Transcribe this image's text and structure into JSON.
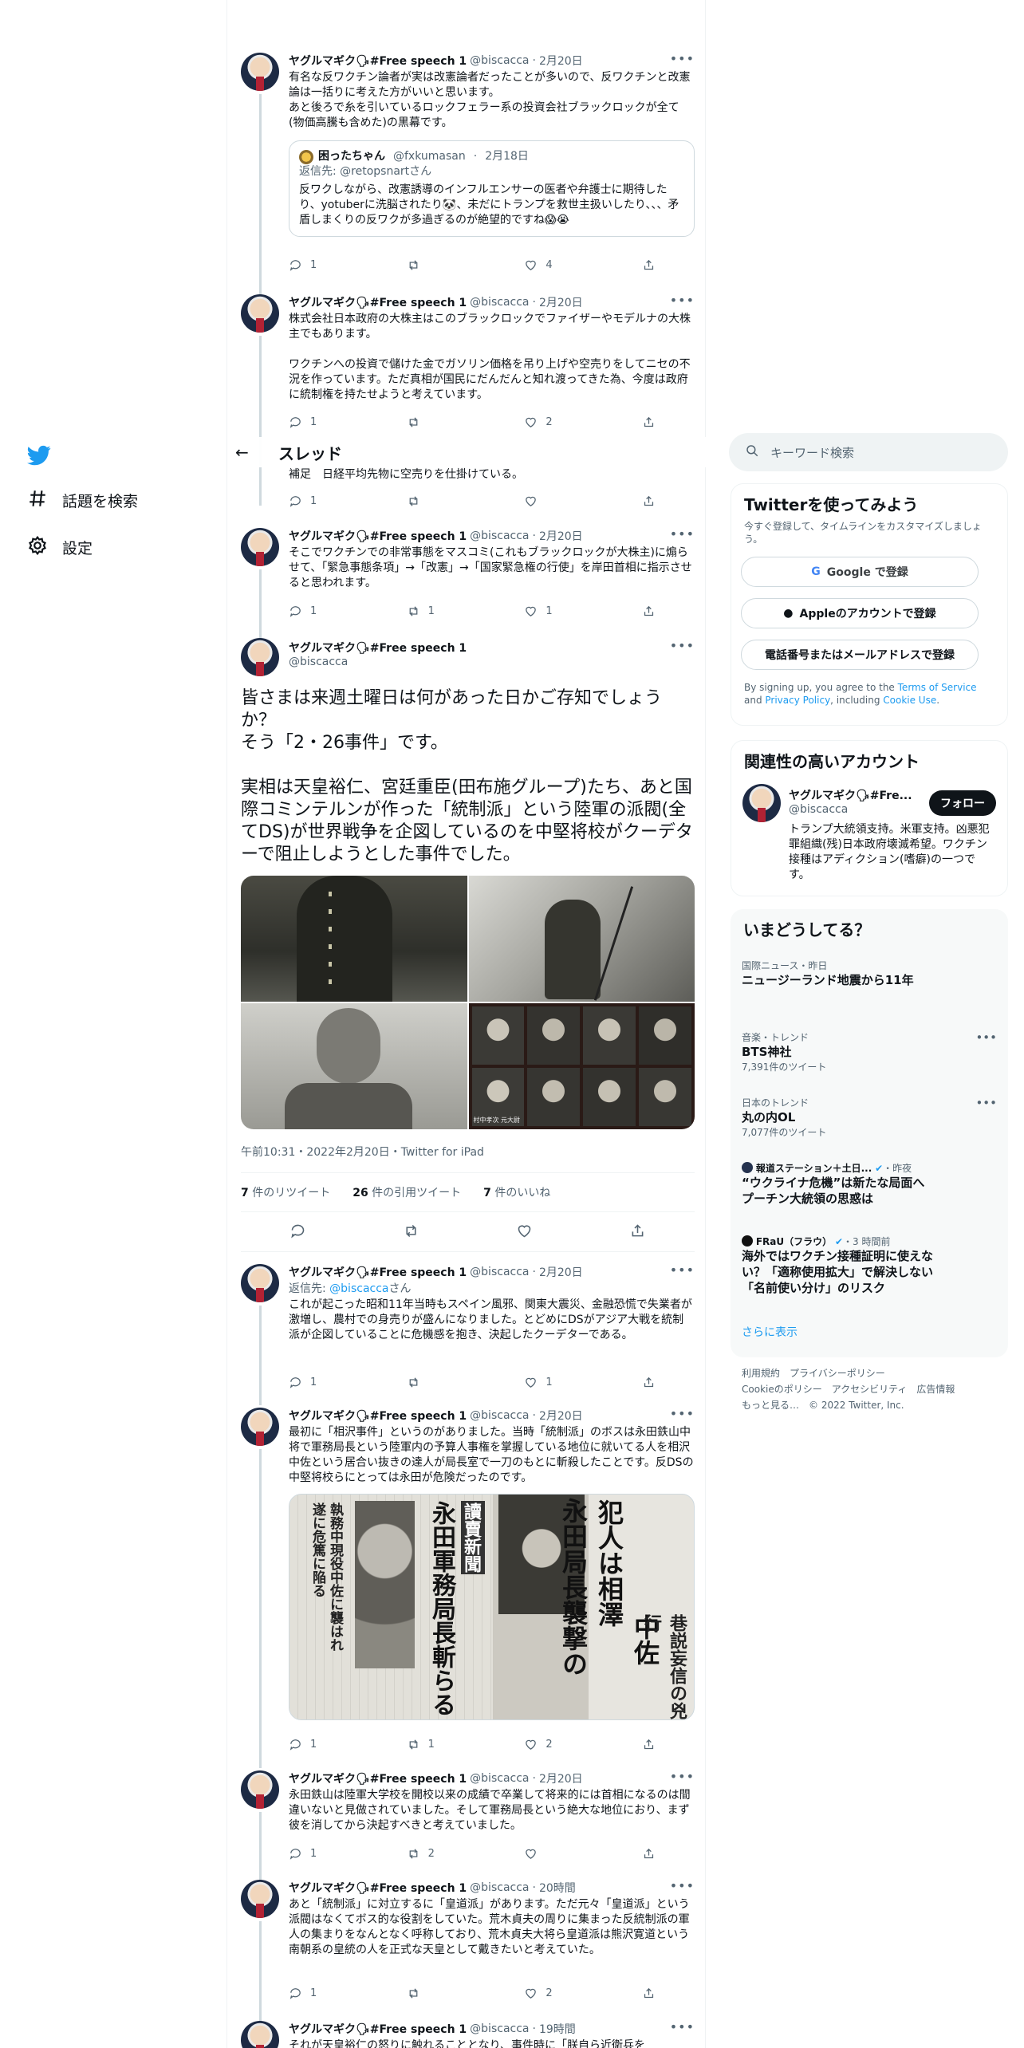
{
  "nav": {
    "topics": "話題を検索",
    "settings": "設定"
  },
  "header": {
    "title": "スレッド"
  },
  "tweets": [
    {
      "name": "ヤグルマギク🗣#Free speech 1",
      "handle": "@biscacca",
      "time": "2月20日",
      "text": "有名な反ワクチン論者が実は改憲論者だったことが多いので、反ワクチンと改憲論は一括りに考えた方がいいと思います。\nあと後ろで糸を引いているロックフェラー系の投資会社ブラックロックが全て(物価高騰も含めた)の黒幕です。",
      "quote": {
        "name": "困ったちゃん",
        "handle": "@fxkumasan",
        "time": "2月18日",
        "reply_label": "返信先:",
        "reply_to": "@retopsnartさん",
        "text": "反ワクしながら、改憲誘導のインフルエンサーの医者や弁護士に期待したり、yotuberに洗脳されたり🐼、未だにトランプを救世主扱いしたり、、、矛盾しまくりの反ワクが多過ぎるのが絶望的ですね😱😭"
      },
      "replies": "1",
      "retweets": "",
      "likes": "4"
    },
    {
      "name": "ヤグルマギク🗣#Free speech 1",
      "handle": "@biscacca",
      "time": "2月20日",
      "text": "株式会社日本政府の大株主はこのブラックロックでファイザーやモデルナの大株主でもあります。\n\nワクチンへの投資で儲けた金でガソリン価格を吊り上げや空売りをしてニセの不況を作っています。ただ真相が国民にだんだんと知れ渡ってきた為、今度は政府に統制権を持たせようと考えています。",
      "replies": "1",
      "retweets": "",
      "likes": "2"
    },
    {
      "text": "補足　日経平均先物に空売りを仕掛けている。",
      "replies": "1",
      "retweets": "",
      "likes": ""
    },
    {
      "name": "ヤグルマギク🗣#Free speech 1",
      "handle": "@biscacca",
      "time": "2月20日",
      "text": "そこでワクチンでの非常事態をマスコミ(これもブラックロックが大株主)に煽らせて、「緊急事態条項」→「改憲」→「国家緊急権の行使」を岸田首相に指示させると思われます。",
      "replies": "1",
      "retweets": "1",
      "likes": "1"
    }
  ],
  "focus": {
    "name": "ヤグルマギク🗣#Free speech 1",
    "handle": "@biscacca",
    "text": "皆さまは来週土曜日は何があった日かご存知でしょうか？\nそう「2・26事件」です。\n\n実相は天皇裕仁、宮廷重臣(田布施グループ)たち、あと国際コミンテルンが作った「統制派」という陸軍の派閥(全てDS)が世界戦争を企図しているのを中堅将校がクーデターで阻止しようとした事件でした。",
    "photo_caption": "村中孝次 元大尉",
    "meta": "午前10:31・2022年2月20日・Twitter for iPad",
    "retweets": "7",
    "retweets_label": "件のリツイート",
    "quotes": "26",
    "quotes_label": "件の引用ツイート",
    "likes": "7",
    "likes_label": "件のいいね"
  },
  "replies": [
    {
      "name": "ヤグルマギク🗣#Free speech 1",
      "handle": "@biscacca",
      "time": "2月20日",
      "reply_label": "返信先:",
      "reply_to": "@biscacca",
      "reply_suffix": "さん",
      "text": "これが起こった昭和11年当時もスペイン風邪、関東大震災、金融恐慌で失業者が激増し、農村での身売りが盛んになりました。とどめにDSがアジア大戦を統制派が企図していることに危機感を抱き、決起したクーデターである。",
      "replies": "1",
      "retweets": "",
      "likes": "1"
    },
    {
      "name": "ヤグルマギク🗣#Free speech 1",
      "handle": "@biscacca",
      "time": "2月20日",
      "text": "最初に「相沢事件」というのがありました。当時「統制派」のボスは永田鉄山中将で軍務局長という陸軍内の予算人事権を掌握している地位に就いてる人を相沢中佐という居合い抜きの達人が局長室で一刀のもとに斬殺したことです。反DSの中堅将校らにとっては永田が危険だったのです。",
      "news": {
        "h1": "永田局長襲撃の",
        "h2": "犯人は相澤",
        "h3": "中佐",
        "h4": "巷説妄信の兇行",
        "paper": "讀賣新聞",
        "left1": "執務中現役中佐に襲はれ",
        "left2": "遂に危篤に陥る",
        "left3": "永田軍務局長斬らる"
      },
      "replies": "1",
      "retweets": "1",
      "likes": "2"
    },
    {
      "name": "ヤグルマギク🗣#Free speech 1",
      "handle": "@biscacca",
      "time": "2月20日",
      "text": "永田鉄山は陸軍大学校を開校以来の成績で卒業して将来的には首相になるのは間違いないと見做されていました。そして軍務局長という絶大な地位におり、まず彼を消してから決起すべきと考えていました。",
      "replies": "1",
      "retweets": "2",
      "likes": ""
    },
    {
      "name": "ヤグルマギク🗣#Free speech 1",
      "handle": "@biscacca",
      "time": "20時間",
      "text": "あと「統制派」に対立するに「皇道派」があります。ただ元々「皇道派」という派閥はなくてボス的な役割をしていた。荒木貞夫の周りに集まった反統制派の軍人の集まりをなんとなく呼称しており、荒木貞夫大将ら皇道派は熊沢寛道という南朝系の皇統の人を正式な天皇として戴きたいと考えていた。",
      "replies": "1",
      "retweets": "",
      "likes": "2"
    },
    {
      "name": "ヤグルマギク🗣#Free speech 1",
      "handle": "@biscacca",
      "time": "19時間",
      "text": "それが天皇裕仁の怒りに触れることとなり、事件時に「朕自ら近衛兵を"
    }
  ],
  "sidebar": {
    "search_placeholder": "キーワード検索",
    "signup": {
      "title": "Twitterを使ってみよう",
      "sub": "今すぐ登録して、タイムラインをカスタマイズしましょう。",
      "google": "Google で登録",
      "apple": "Appleのアカウントで登録",
      "phone": "電話番号またはメールアドレスで登録",
      "terms_pre": "By signing up, you agree to the ",
      "terms": "Terms of Service",
      "and": " and ",
      "privacy": "Privacy Policy",
      "including": ", including ",
      "cookie": "Cookie Use",
      "end": "."
    },
    "related": {
      "title": "関連性の高いアカウント",
      "name": "ヤグルマギク🗣#Fre...",
      "handle": "@biscacca",
      "follow": "フォロー",
      "bio": "トランプ大統領支持。米軍支持。凶悪犯罪組織(残)日本政府壊滅希望。ワクチン接種はアディクション(嗜癖)の一つです。"
    },
    "trends": {
      "title": "いまどうしてる？",
      "items": [
        {
          "cat": "国際ニュース・昨日",
          "topic": "ニュージーランド地震から11年"
        },
        {
          "cat": "音楽・トレンド",
          "topic": "BTS神社",
          "count": "7,391件のツイート"
        },
        {
          "cat": "日本のトレンド",
          "topic": "丸の内OL",
          "count": "7,077件のツイート"
        },
        {
          "source": "報道ステーション＋土日...",
          "when": "・昨夜",
          "topic": "“ウクライナ危機”は新たな局面へ　プーチン大統領の思惑は"
        },
        {
          "source": "FRaU（フラウ）",
          "when": "・3 時間前",
          "topic": "海外ではワクチン接種証明に使えない？「適称使用拡大」で解決しない「名前使い分け」のリスク"
        }
      ],
      "more": "さらに表示"
    },
    "footer": {
      "l1": "利用規約　プライバシーポリシー",
      "l2": "Cookieのポリシー　アクセシビリティ　広告情報",
      "l3": "もっと見る…　© 2022 Twitter, Inc."
    }
  },
  "colors": {
    "accent": "#1d9bf0",
    "text": "#0f1419",
    "muted": "#536471",
    "border": "#eff3f4"
  }
}
